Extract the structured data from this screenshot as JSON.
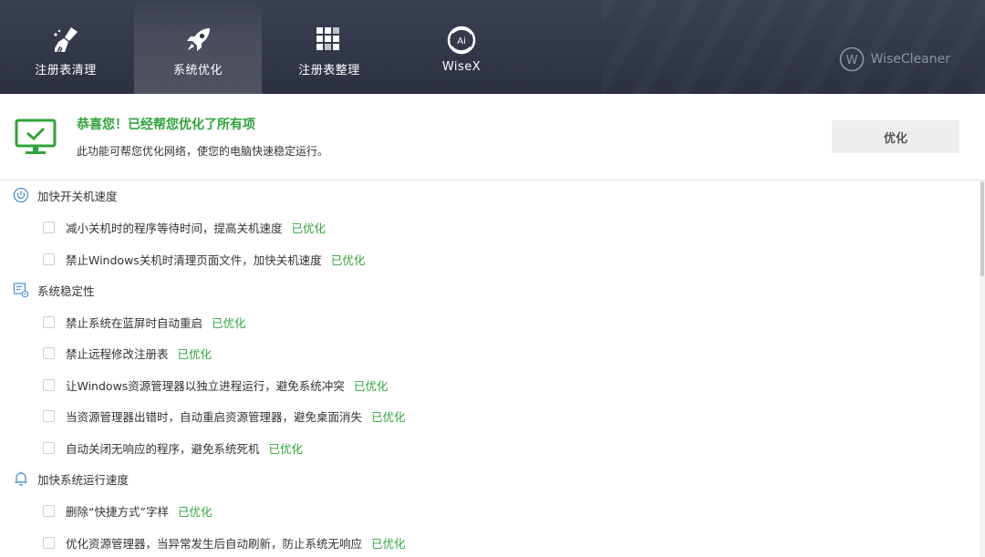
{
  "nav": {
    "tabs": [
      {
        "label": "注册表清理",
        "icon": "broom-icon"
      },
      {
        "label": "系统优化",
        "icon": "rocket-icon",
        "active": true
      },
      {
        "label": "注册表整理",
        "icon": "grid-icon"
      },
      {
        "label": "WiseX",
        "icon": "wisex-ai-icon"
      }
    ],
    "brand": "WiseCleaner"
  },
  "header": {
    "title": "恭喜您！已经帮您优化了所有项",
    "subtitle": "此功能可帮您优化网络，使您的电脑快速稳定运行。",
    "button": "优化"
  },
  "colors": {
    "accent_green": "#2fa33a",
    "topbar": "#2f3445",
    "section_icon": "#4a90d9"
  },
  "sections": [
    {
      "title": "加快开关机速度",
      "icon": "power-icon",
      "items": [
        {
          "label": "减小关机时的程序等待时间，提高关机速度",
          "status": "已优化"
        },
        {
          "label": "禁止Windows关机时清理页面文件，加快关机速度",
          "status": "已优化"
        }
      ]
    },
    {
      "title": "系统稳定性",
      "icon": "stability-settings-icon",
      "items": [
        {
          "label": "禁止系统在蓝屏时自动重启",
          "status": "已优化"
        },
        {
          "label": "禁止远程修改注册表",
          "status": "已优化"
        },
        {
          "label": "让Windows资源管理器以独立进程运行，避免系统冲突",
          "status": "已优化"
        },
        {
          "label": "当资源管理器出错时，自动重启资源管理器，避免桌面消失",
          "status": "已优化"
        },
        {
          "label": "自动关闭无响应的程序，避免系统死机",
          "status": "已优化"
        }
      ]
    },
    {
      "title": "加快系统运行速度",
      "icon": "bell-icon",
      "items": [
        {
          "label": "删除“快捷方式”字样",
          "status": "已优化"
        },
        {
          "label": "优化资源管理器，当异常发生后自动刷新，防止系统无响应",
          "status": "已优化"
        }
      ]
    }
  ]
}
